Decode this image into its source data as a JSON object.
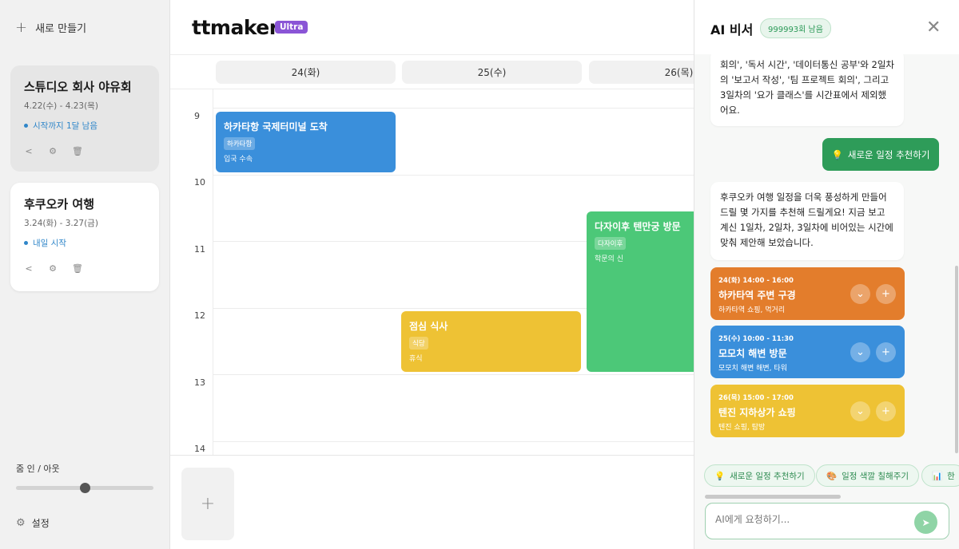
{
  "sidebar": {
    "new_label": "새로 만들기",
    "trips": [
      {
        "title": "스튜디오 회사 야유회",
        "dates": "4.22(수) - 4.23(목)",
        "status": "시작까지 1달 남음"
      },
      {
        "title": "후쿠오카 여행",
        "dates": "3.24(화) - 3.27(금)",
        "status": "내일 시작"
      }
    ],
    "zoom_label": "줌 인 / 아웃",
    "zoom_value": 0.5,
    "settings_label": "설정"
  },
  "header": {
    "logo": "ttmaker",
    "plan_badge": "Ultra"
  },
  "calendar": {
    "days": [
      "24(화)",
      "25(수)",
      "26(목)"
    ],
    "hours": [
      "9",
      "10",
      "11",
      "12",
      "13",
      "14"
    ],
    "events": [
      {
        "title": "하카타항 국제터미널 도착",
        "tag": "하카타항",
        "desc": "입국 수속",
        "color": "#3a8fdb"
      },
      {
        "title": "점심 식사",
        "tag": "식당",
        "desc": "휴식",
        "color": "#eec234"
      },
      {
        "title": "다자이후 텐만궁 방문",
        "tag": "다자이후",
        "desc": "학문의 신",
        "color": "#4cc878"
      }
    ]
  },
  "ai": {
    "title": "AI 비서",
    "remaining": "999993회 남음",
    "messages": {
      "bot1": "회의', '독서 시간', '데이터통신 공부'와 2일차의 '보고서 작성', '팀 프로젝트 회의', 그리고 3일차의 '요가 클래스'를 시간표에서 제외했어요.",
      "user1": "새로운 일정 추천하기",
      "bot2": "후쿠오카 여행 일정을 더욱 풍성하게 만들어 드릴 몇 가지를 추천해 드릴게요! 지금 보고 계신 1일차, 2일차, 3일차에 비어있는 시간에 맞춰 제안해 보았습니다."
    },
    "suggestions": [
      {
        "time": "24(화) 14:00 - 16:00",
        "title": "하카타역 주변 구경",
        "desc": "하카타역 쇼핑, 먹거리",
        "color": "#e37d2c"
      },
      {
        "time": "25(수) 10:00 - 11:30",
        "title": "모모치 해변 방문",
        "desc": "모모치 해변 해변, 타워",
        "color": "#3a8fdb"
      },
      {
        "time": "26(목) 15:00 - 17:00",
        "title": "텐진 지하상가 쇼핑",
        "desc": "텐진 쇼핑, 탐방",
        "color": "#eec234"
      }
    ],
    "quick_actions": [
      "새로운 일정 추천하기",
      "일정 색깔 칠해주기",
      "한"
    ],
    "input_placeholder": "AI에게 요청하기..."
  }
}
